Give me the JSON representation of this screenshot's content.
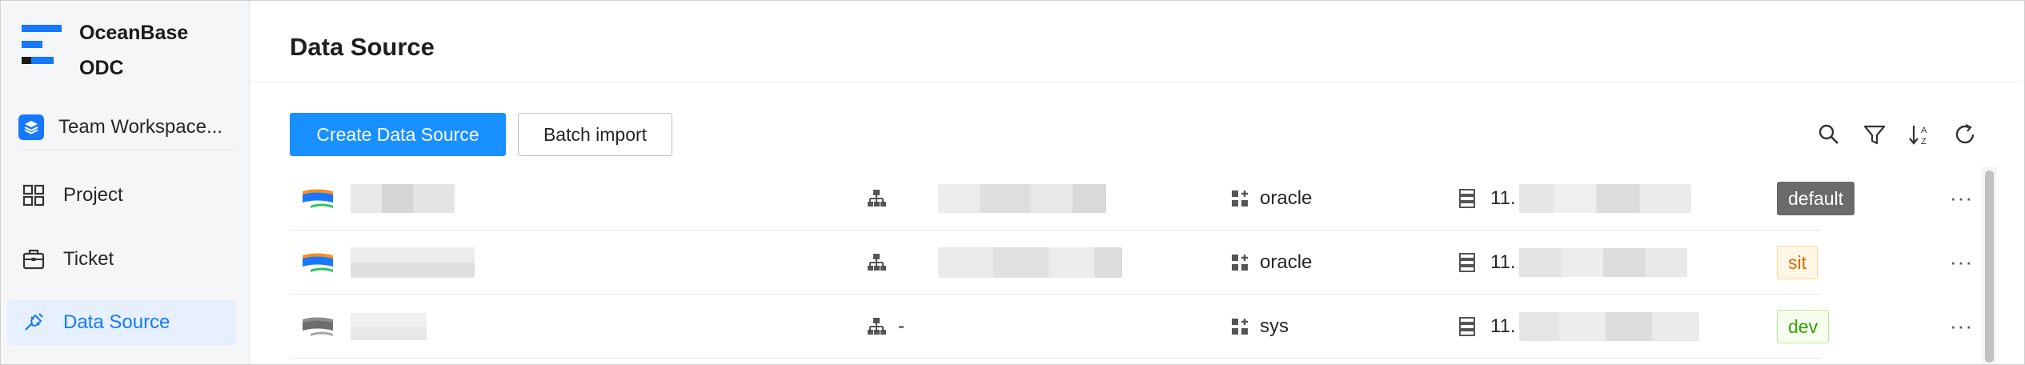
{
  "brand": {
    "name_line1": "OceanBase",
    "name_line2": "ODC"
  },
  "workspace": {
    "label": "Team Workspace...",
    "icon": "layers-icon"
  },
  "nav": [
    {
      "label": "Project",
      "icon": "grid-icon",
      "active": false
    },
    {
      "label": "Ticket",
      "icon": "briefcase-icon",
      "active": false
    },
    {
      "label": "Data Source",
      "icon": "plug-icon",
      "active": true
    }
  ],
  "page": {
    "title": "Data Source",
    "create_button": "Create Data Source",
    "batch_import_button": "Batch import",
    "toolbar_icons": [
      "search-icon",
      "filter-icon",
      "sort-az-icon",
      "refresh-icon"
    ]
  },
  "rows": [
    {
      "cluster": "",
      "tenant": "oracle",
      "host": "11.",
      "tag": "default",
      "db_icon": "oceanbase-color-icon"
    },
    {
      "cluster": "",
      "tenant": "oracle",
      "host": "11.",
      "tag": "sit",
      "db_icon": "oceanbase-color-icon"
    },
    {
      "cluster": "-",
      "tenant": "sys",
      "host": "11.",
      "tag": "dev",
      "db_icon": "oceanbase-gray-icon"
    }
  ],
  "more_label": "···",
  "colors": {
    "primary": "#1890ff",
    "active_nav_bg": "#e6f0ff",
    "tag_default_bg": "#6b6b6b",
    "tag_sit": "#d46b08",
    "tag_dev": "#389e0d"
  }
}
